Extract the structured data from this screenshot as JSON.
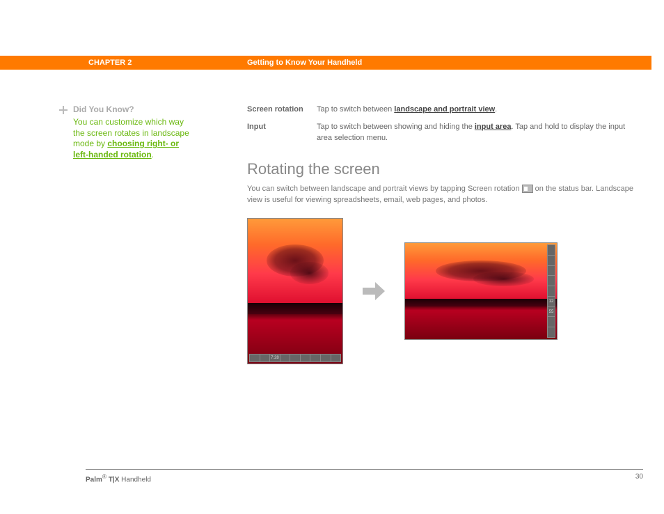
{
  "header": {
    "chapter": "CHAPTER 2",
    "title": "Getting to Know Your Handheld"
  },
  "sidebar": {
    "heading": "Did You Know?",
    "body_before": "You can customize which way the screen rotates in landscape mode by ",
    "link": "choosing right- or left-handed rotation",
    "body_after": "."
  },
  "defs": {
    "row1": {
      "term": "Screen rotation",
      "before": "Tap to switch between ",
      "link": "landscape and portrait view",
      "after": "."
    },
    "row2": {
      "term": "Input",
      "before": "Tap to switch between showing and hiding the ",
      "link": "input area",
      "after": ". Tap and hold to display the input area selection menu."
    }
  },
  "section": {
    "heading": "Rotating the screen",
    "para_before": "You can switch between landscape and portrait views by tapping Screen rotation ",
    "para_after": " on the status bar. Landscape view is useful for viewing spreadsheets, email, web pages, and photos."
  },
  "status": {
    "time": "7:28",
    "v1": "12",
    "v2": "55"
  },
  "footer": {
    "brand_prefix": "Palm",
    "brand_sup": "®",
    "brand_model": " T|X",
    "brand_suffix": " Handheld",
    "page": "30"
  }
}
